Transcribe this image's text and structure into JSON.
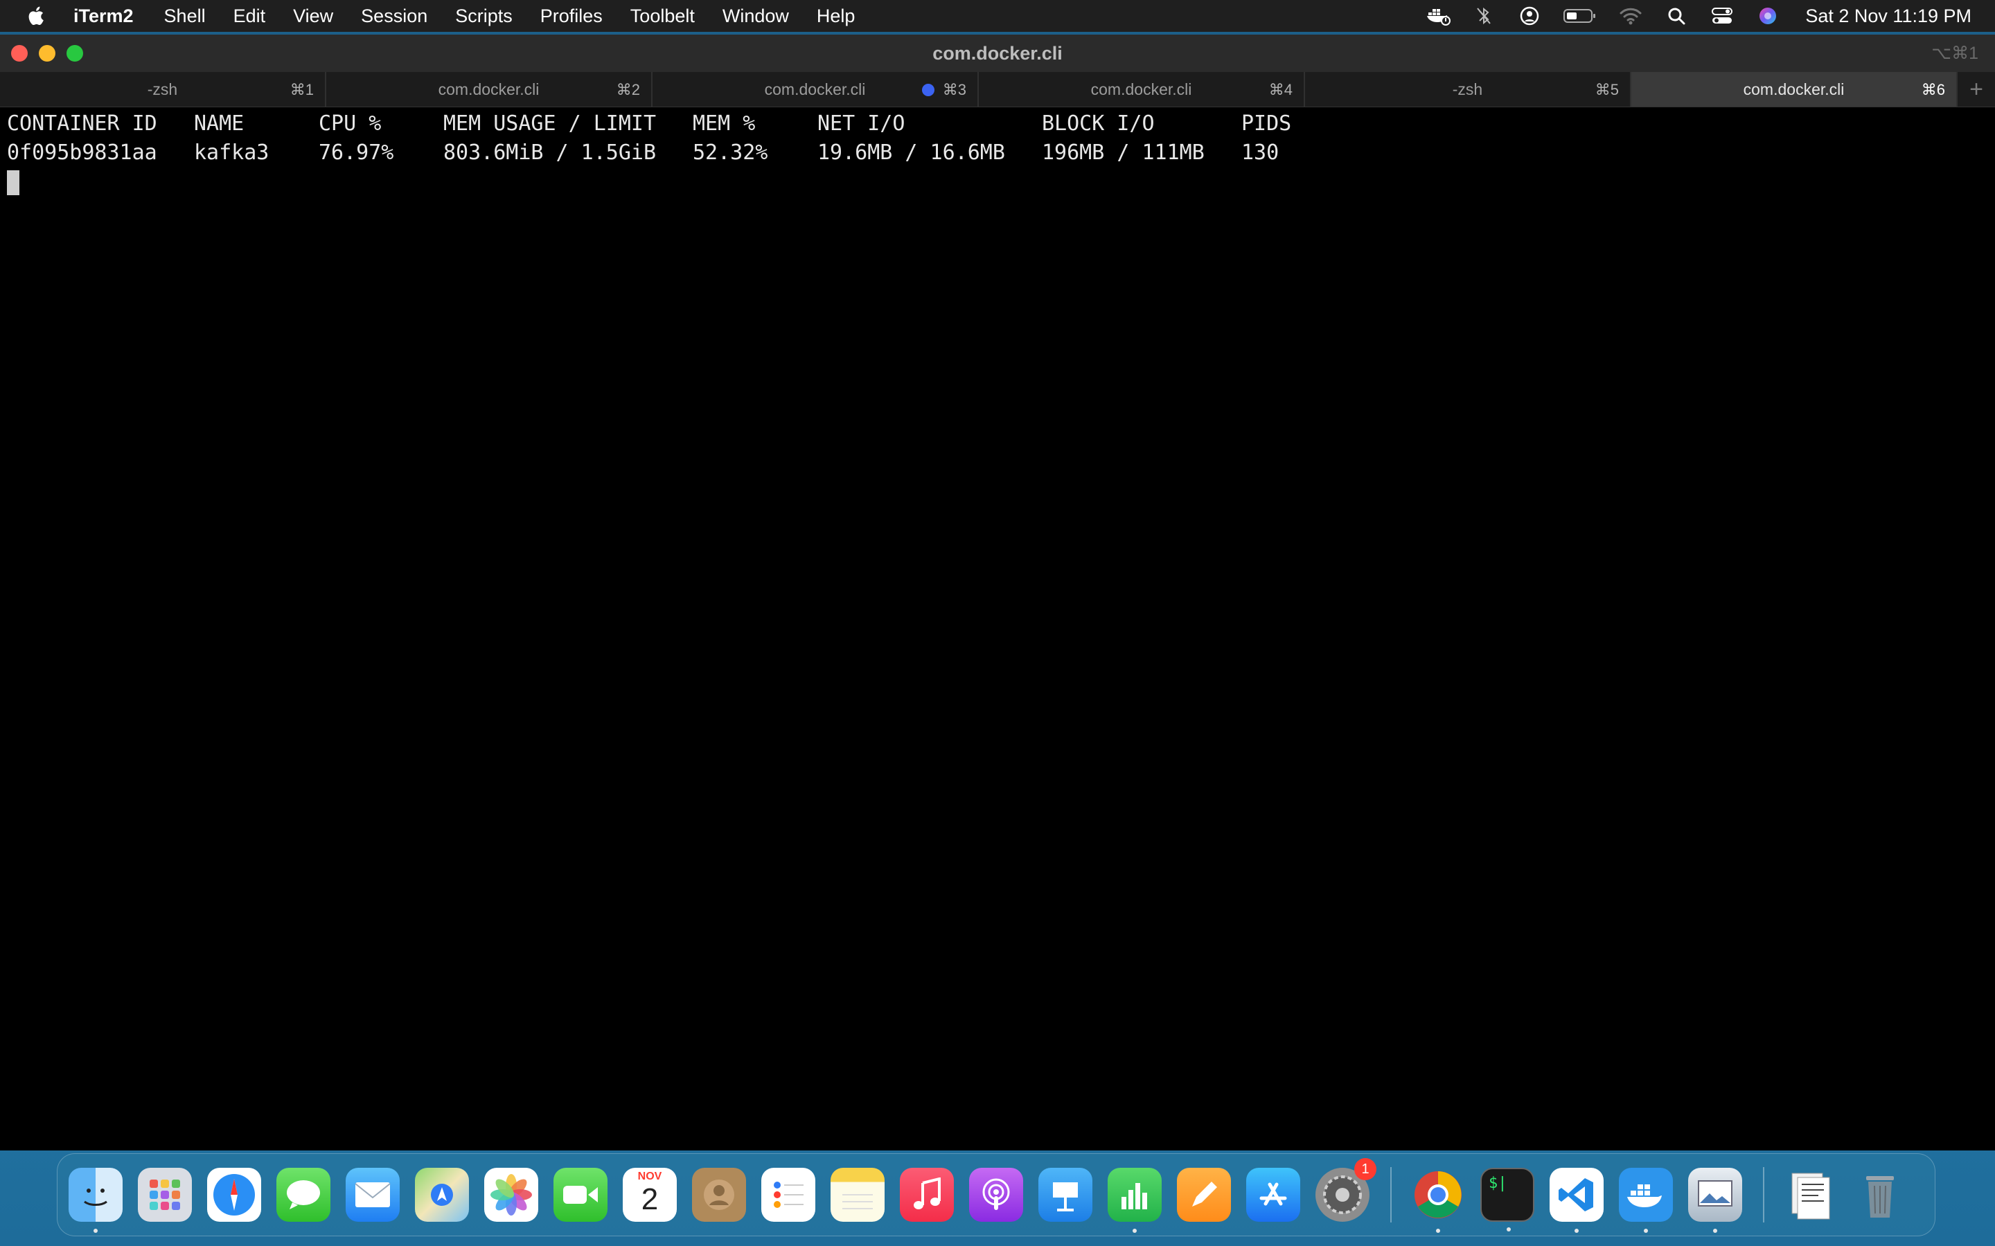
{
  "menubar": {
    "app_name": "iTerm2",
    "items": [
      "Shell",
      "Edit",
      "View",
      "Session",
      "Scripts",
      "Profiles",
      "Toolbelt",
      "Window",
      "Help"
    ],
    "clock": "Sat 2 Nov  11:19 PM",
    "status_icons": [
      "docker-status-icon",
      "bluetooth-icon",
      "user-icon",
      "battery-icon",
      "wifi-icon",
      "search-icon",
      "control-center-icon",
      "siri-icon"
    ]
  },
  "window": {
    "title": "com.docker.cli",
    "title_shortcut": "⌥⌘1",
    "tabs": [
      {
        "label": "-zsh",
        "shortcut": "⌘1"
      },
      {
        "label": "com.docker.cli",
        "shortcut": "⌘2"
      },
      {
        "label": "com.docker.cli",
        "shortcut": "⌘3",
        "activity": true
      },
      {
        "label": "com.docker.cli",
        "shortcut": "⌘4"
      },
      {
        "label": "-zsh",
        "shortcut": "⌘5"
      },
      {
        "label": "com.docker.cli",
        "shortcut": "⌘6",
        "active": true
      }
    ],
    "new_tab": "+"
  },
  "terminal": {
    "headers": [
      "CONTAINER ID",
      "NAME",
      "CPU %",
      "MEM USAGE / LIMIT",
      "MEM %",
      "NET I/O",
      "BLOCK I/O",
      "PIDS"
    ],
    "rows": [
      [
        "0f095b9831aa",
        "kafka3",
        "76.97%",
        "803.6MiB / 1.5GiB",
        "52.32%",
        "19.6MB / 16.6MB",
        "196MB / 111MB",
        "130"
      ]
    ]
  },
  "dock": {
    "calendar": {
      "month": "NOV",
      "day": "2"
    },
    "settings_badge": "1",
    "terminal_glyph": "$|"
  },
  "colors": {
    "menubar_bg": "#1f1f1f",
    "terminal_bg": "#000000",
    "active_tab": "#3a3a3a",
    "activity_dot": "#3b63f2",
    "close": "#ff5f57",
    "minimize": "#febc2e",
    "zoom": "#28c840"
  }
}
